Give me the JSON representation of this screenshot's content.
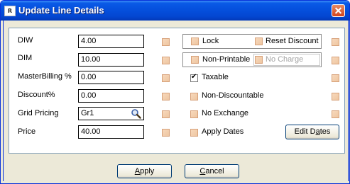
{
  "window": {
    "title": "Update Line Details",
    "app_icon": "app-icon"
  },
  "fields": [
    {
      "label": "DIW",
      "value": "4.00"
    },
    {
      "label": "DIM",
      "value": "10.00"
    },
    {
      "label": "MasterBilling %",
      "value": "0.00"
    },
    {
      "label": "Discount%",
      "value": "0.00"
    },
    {
      "label": "Grid Pricing",
      "value": "Gr1"
    },
    {
      "label": "Price",
      "value": "40.00"
    }
  ],
  "options": {
    "lock": {
      "label": "Lock",
      "checked": false
    },
    "reset_discount": {
      "label": "Reset Discount",
      "checked": false
    },
    "non_printable": {
      "label": "Non-Printable",
      "checked": false
    },
    "no_charge": {
      "label": "No Charge",
      "checked": false,
      "disabled": true
    },
    "taxable": {
      "label": "Taxable",
      "checked": true
    },
    "non_discountable": {
      "label": "Non-Discountable",
      "checked": false
    },
    "no_exchange": {
      "label": "No Exchange",
      "checked": false
    },
    "apply_dates": {
      "label": "Apply Dates",
      "checked": false
    }
  },
  "buttons": {
    "edit_dates": {
      "pre": "Edit D",
      "ul": "a",
      "post": "tes"
    },
    "apply": {
      "pre": "",
      "ul": "A",
      "post": "pply"
    },
    "cancel": {
      "pre": "",
      "ul": "C",
      "post": "ancel"
    }
  },
  "colors": {
    "titlebar": "#0550dd",
    "checkbox_fill": "#f0c8a4",
    "close": "#d3441d"
  }
}
